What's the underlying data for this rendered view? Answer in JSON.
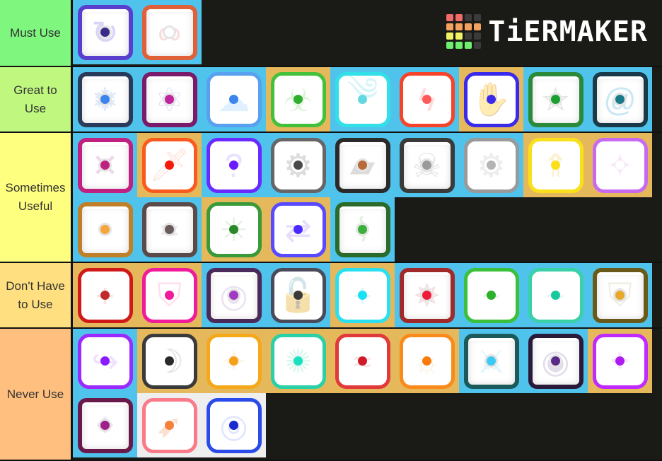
{
  "logo": {
    "text": "TiERMAKER",
    "grid": [
      "#f26b6b",
      "#f26b6b",
      "#3b3b3b",
      "#3b3b3b",
      "#f5a15e",
      "#f5a15e",
      "#f5a15e",
      "#f5a15e",
      "#f2f266",
      "#f2f266",
      "#3b3b3b",
      "#3b3b3b",
      "#6ef06e",
      "#6ef06e",
      "#6ef06e",
      "#3b3b3b"
    ]
  },
  "tiers": [
    {
      "label": "Must Use",
      "color": "#7ff77f",
      "items": [
        {
          "name": "retry-orb",
          "bg": "blue",
          "style": "dragon",
          "frame": "#5a3fcf",
          "motif": "↻",
          "motifColor": "#9b87e8",
          "dot": "#3a2a8a"
        },
        {
          "name": "infinity-orb",
          "bg": "blue",
          "style": "dragon",
          "frame": "#e0603a",
          "motif": "∞",
          "motifColor": "#f0a0a0",
          "dot": "#ffffff"
        }
      ]
    },
    {
      "label": "Great to Use",
      "color": "#bff77f",
      "items": [
        {
          "name": "snowflake-orb",
          "bg": "blue",
          "style": "dragon",
          "frame": "#2a3a5a",
          "motif": "❄",
          "motifColor": "#9ec4ee",
          "dot": "#3a86ee"
        },
        {
          "name": "atom-orb",
          "bg": "blue",
          "style": "dragon",
          "frame": "#7a1a6a",
          "motif": "⚛",
          "motifColor": "#b49af0",
          "dot": "#c0249e"
        },
        {
          "name": "cloud-orb",
          "bg": "blue",
          "style": "plain",
          "frame": "#5aa0f0",
          "motif": "☁",
          "motifColor": "#a8d4ff",
          "dot": "#3a86ee"
        },
        {
          "name": "biohazard-orb",
          "bg": "gold",
          "style": "plain",
          "frame": "#44c13a",
          "motif": "☣",
          "motifColor": "#8ede86",
          "dot": "#2fae2f"
        },
        {
          "name": "swirl-orb",
          "bg": "blue",
          "style": "plain",
          "frame": "#32e0e8",
          "motif": "༄",
          "motifColor": "#8ee0ee",
          "dot": "#64d8e0"
        },
        {
          "name": "lightning-orb",
          "bg": "blue",
          "style": "plain",
          "frame": "#f5442a",
          "motif": "ϟ",
          "motifColor": "#ff9a9a",
          "dot": "#ff5a5a"
        },
        {
          "name": "healing-hands-orb",
          "bg": "gold",
          "style": "plain",
          "frame": "#3a2aea",
          "motif": "✋",
          "motifColor": "#9a9af0",
          "dot": "#3a2aea"
        },
        {
          "name": "pentagram-orb",
          "bg": "blue",
          "style": "dragon",
          "frame": "#2a8a3a",
          "motif": "⛤",
          "motifColor": "#a8b8a8",
          "dot": "#1aa030"
        },
        {
          "name": "vortex-orb",
          "bg": "blue",
          "style": "dragon",
          "frame": "#1a3a4a",
          "motif": "@",
          "motifColor": "#6ac0e0",
          "dot": "#1a7a8a"
        }
      ]
    },
    {
      "label": "Sometimes Useful",
      "color": "#ffff7f",
      "items": [
        {
          "name": "syringe-orb",
          "bg": "blue",
          "style": "dragon",
          "frame": "#c02080",
          "motif": "✕",
          "motifColor": "#d090c0",
          "dot": "#c02080"
        },
        {
          "name": "sword-burst-orb",
          "bg": "gold",
          "style": "plain",
          "frame": "#fa5a1e",
          "motif": "🗡",
          "motifColor": "#ffb8a0",
          "dot": "#f51a0a"
        },
        {
          "name": "question-orb",
          "bg": "blue",
          "style": "plain",
          "frame": "#6a2aff",
          "motif": "?",
          "motifColor": "#b8b0ff",
          "dot": "#6a1aff"
        },
        {
          "name": "gears-orb",
          "bg": "blue",
          "style": "plain",
          "frame": "#666666",
          "motif": "⚙",
          "motifColor": "#9a9a9a",
          "dot": "#4a4a4a"
        },
        {
          "name": "pistol-orb",
          "bg": "blue",
          "style": "dragon",
          "frame": "#2a2a2a",
          "motif": "▰",
          "motifColor": "#9a9a9a",
          "dot": "#b86a3a"
        },
        {
          "name": "skull-orb",
          "bg": "blue",
          "style": "dragon",
          "frame": "#3a3a3a",
          "motif": "☠",
          "motifColor": "#a8a8a8",
          "dot": "#9a9a9a"
        },
        {
          "name": "white-gear-orb",
          "bg": "blue",
          "style": "plain",
          "frame": "#9a9a9a",
          "motif": "⚙",
          "motifColor": "#cccccc",
          "dot": "#b4b4b4"
        },
        {
          "name": "rising-arrows-orb",
          "bg": "gold",
          "style": "plain",
          "frame": "#fae01a",
          "motif": "⇑",
          "motifColor": "#f5d878",
          "dot": "#fae01a"
        },
        {
          "name": "prism-orb",
          "bg": "gold",
          "style": "plain",
          "frame": "#c86af0",
          "motif": "✦",
          "motifColor": "#e8b8e8",
          "dot": "#ffffff"
        },
        {
          "name": "golden-dust-orb",
          "bg": "blue",
          "style": "dragon",
          "frame": "#c0802a",
          "motif": "·",
          "motifColor": "#e0b890",
          "dot": "#f5a53a"
        },
        {
          "name": "gray-wind-orb",
          "bg": "blue",
          "style": "dragon",
          "frame": "#5a4a4a",
          "motif": "≈",
          "motifColor": "#c8c0c0",
          "dot": "#6a5a5a"
        },
        {
          "name": "thorn-orb",
          "bg": "gold",
          "style": "plain",
          "frame": "#3a9a3a",
          "motif": "✳",
          "motifColor": "#a8d8a8",
          "dot": "#2a8a2a"
        },
        {
          "name": "swap-orb",
          "bg": "gold",
          "style": "plain",
          "frame": "#5a4aff",
          "motif": "⇄",
          "motifColor": "#c0a0f0",
          "dot": "#4a2aff"
        },
        {
          "name": "vine-orb",
          "bg": "blue",
          "style": "dragon",
          "frame": "#2a6a2a",
          "motif": "⌇",
          "motifColor": "#a8dca8",
          "dot": "#3ab03a"
        }
      ]
    },
    {
      "label": "Don't Have to Use",
      "color": "#ffdf7f",
      "items": [
        {
          "name": "red-cross-orb",
          "bg": "gold",
          "style": "plain",
          "frame": "#d01a1a",
          "motif": "+",
          "motifColor": "#f0b0b0",
          "dot": "#c02a2a"
        },
        {
          "name": "broken-shield-orb",
          "bg": "gold",
          "style": "plain",
          "frame": "#f01a9a",
          "motif": "⛉",
          "motifColor": "#ffa0d0",
          "dot": "#f01a9a"
        },
        {
          "name": "purple-ring-orb",
          "bg": "blue",
          "style": "dragon",
          "frame": "#4a2a5a",
          "motif": "◎",
          "motifColor": "#c8b0d8",
          "dot": "#a03ac0"
        },
        {
          "name": "unlock-orb",
          "bg": "blue",
          "style": "plain",
          "frame": "#4a4a5a",
          "motif": "🔓",
          "motifColor": "#8a8a8a",
          "dot": "#3a3a3a"
        },
        {
          "name": "cyan-cross-orb",
          "bg": "gold",
          "style": "plain",
          "frame": "#2ae0f0",
          "motif": "+",
          "motifColor": "#a0e8f0",
          "dot": "#1ae0f5"
        },
        {
          "name": "compass-orb",
          "bg": "blue",
          "style": "dragon",
          "frame": "#a02a2a",
          "motif": "✵",
          "motifColor": "#e0a0a0",
          "dot": "#f01a3a"
        },
        {
          "name": "green-slime-orb",
          "bg": "blue",
          "style": "plain",
          "frame": "#3ac03a",
          "motif": "~",
          "motifColor": "#b0e8b0",
          "dot": "#2ab02a"
        },
        {
          "name": "teal-wave-orb",
          "bg": "blue",
          "style": "plain",
          "frame": "#3ad0a8",
          "motif": "~",
          "motifColor": "#b0e8d8",
          "dot": "#1ac8a0"
        },
        {
          "name": "holy-shield-orb",
          "bg": "blue",
          "style": "dragon",
          "frame": "#6a5a1a",
          "motif": "⛨",
          "motifColor": "#d8d0b0",
          "dot": "#e8a82a"
        }
      ]
    },
    {
      "label": "Never Use",
      "color": "#ffbf7f",
      "items": [
        {
          "name": "purple-arrows-orb",
          "bg": "blue",
          "style": "plain",
          "frame": "#9a2aff",
          "motif": "↪",
          "motifColor": "#d8a8f8",
          "dot": "#8a1aff"
        },
        {
          "name": "scythe-orb",
          "bg": "gold",
          "style": "plain",
          "frame": "#3a3a3a",
          "motif": "☽",
          "motifColor": "#a8a8a8",
          "dot": "#2a2a2a"
        },
        {
          "name": "orange-shatter-orb",
          "bg": "gold",
          "style": "plain",
          "frame": "#f5a81a",
          "motif": "✧",
          "motifColor": "#f8d8b0",
          "dot": "#f5a01a"
        },
        {
          "name": "teal-splash-orb",
          "bg": "gold",
          "style": "plain",
          "frame": "#2ad0a8",
          "motif": "✺",
          "motifColor": "#a0e8d8",
          "dot": "#1ae0c0"
        },
        {
          "name": "red-smoke-orb",
          "bg": "gold",
          "style": "plain",
          "frame": "#e03a3a",
          "motif": "≈",
          "motifColor": "#f0b0b0",
          "dot": "#d01a2a"
        },
        {
          "name": "sun-orb",
          "bg": "gold",
          "style": "plain",
          "frame": "#fa8a1a",
          "motif": "☼",
          "motifColor": "#f8d8a0",
          "dot": "#fa7a0a"
        },
        {
          "name": "ice-sword-orb",
          "bg": "blue",
          "style": "dragon",
          "frame": "#1a5a5a",
          "motif": "⚔",
          "motifColor": "#a0e8f8",
          "dot": "#3ac8f5"
        },
        {
          "name": "shadow-eye-orb",
          "bg": "blue",
          "style": "dragon",
          "frame": "#2a1a3a",
          "motif": "◉",
          "motifColor": "#b0a0c8",
          "dot": "#5a2a8a"
        },
        {
          "name": "magenta-spark-orb",
          "bg": "gold",
          "style": "plain",
          "frame": "#c02aff",
          "motif": "⁘",
          "motifColor": "#f0b0f8",
          "dot": "#b01af5"
        },
        {
          "name": "berry-orb",
          "bg": "blue",
          "style": "dragon",
          "frame": "#6a1a4a",
          "motif": "⁘",
          "motifColor": "#d8b8f0",
          "dot": "#a0208a"
        },
        {
          "name": "bow-arrow-orb",
          "bg": "white",
          "style": "plain",
          "frame": "#fa7a8a",
          "motif": "➹",
          "motifColor": "#f0a878",
          "dot": "#f5803a"
        },
        {
          "name": "bubble-orb",
          "bg": "white",
          "style": "plain",
          "frame": "#2a4aea",
          "motif": "◎",
          "motifColor": "#a8b8f8",
          "dot": "#1a2ad0"
        }
      ]
    }
  ]
}
